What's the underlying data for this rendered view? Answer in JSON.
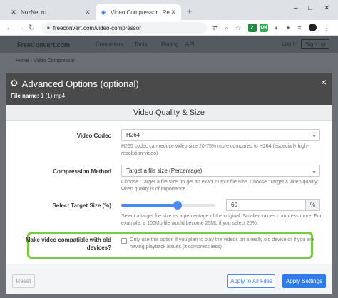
{
  "browser": {
    "tabs": [
      {
        "title": "NozNet.ru",
        "icon": "noznet-favicon-icon"
      },
      {
        "title": "Video Compressor | Reduce Vide",
        "icon": "freeconvert-favicon-icon"
      }
    ],
    "new_tab": "+",
    "window_controls": {
      "minimize": "–",
      "maximize": "□",
      "close": "✕"
    },
    "address": "freeconvert.com/video-compressor",
    "extensions_badge": "ON"
  },
  "site": {
    "logo": "FreeConvert.com",
    "nav": [
      "Converters",
      "Tools",
      "Pricing",
      "API"
    ],
    "login": "Log In",
    "signup": "Sign Up",
    "breadcrumb": "Home › Video Compressor"
  },
  "modal": {
    "title": "Advanced Options (optional)",
    "file_label": "File name:",
    "file_name": "1 (1).mp4",
    "close": "×",
    "section": "Video Quality & Size",
    "video_codec": {
      "label": "Video Codec",
      "value": "H264",
      "help": "H265 codec can reduce video size 20-75% more compared to H264 (especially high-resolution video)"
    },
    "compression_method": {
      "label": "Compression Method",
      "value": "Target a file size (Percentage)",
      "help": "Choose \"Target a file size\" to get an exact output file size. Choose \"Target a video quality\" when quality is of importance."
    },
    "target_size": {
      "label": "Select Target Size (%)",
      "value": "60",
      "slider_fraction": 0.6,
      "unit": "%",
      "help": "Select a target file size as a percentage of the original. Smaller values compress more. For example, a 100Mb file would become 25Mb if you select 25%."
    },
    "compat": {
      "label": "Make video compatible with old devices?",
      "checked": false,
      "help": "Only use this option if you plan to play the videos on a really old device or if you are having playback issues (it compress less)"
    },
    "buttons": {
      "reset": "Reset",
      "apply_all": "Apply to All Files",
      "apply": "Apply Settings"
    }
  },
  "colors": {
    "accent": "#2f7ce8",
    "highlight": "#7ac943",
    "header": "#4a4a4a"
  }
}
